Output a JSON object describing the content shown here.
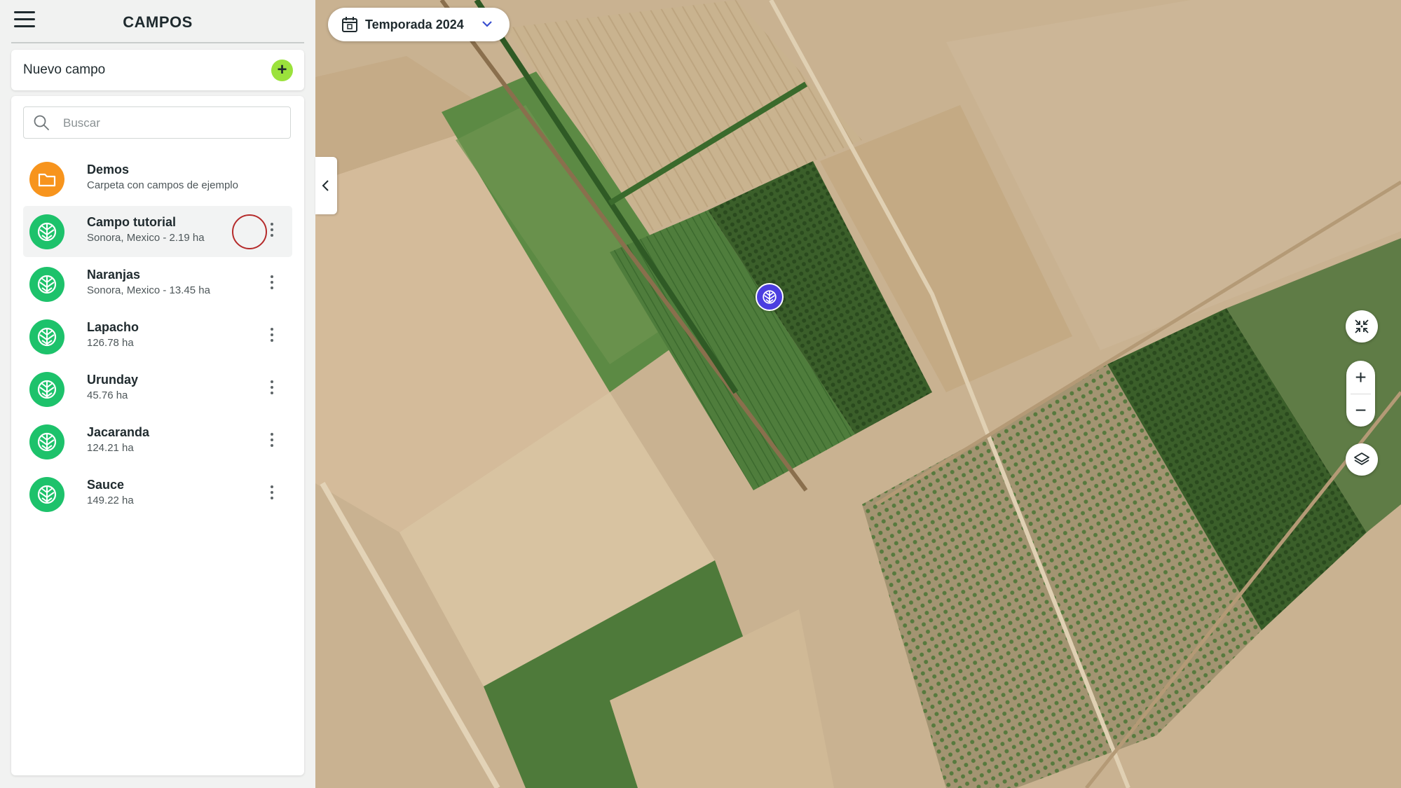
{
  "sidebar": {
    "title": "CAMPOS",
    "new_field_label": "Nuevo campo",
    "new_field_icon": "plus-icon",
    "search": {
      "placeholder": "Buscar",
      "value": ""
    },
    "items": [
      {
        "name": "Demos",
        "subtitle": "Carpeta con campos de ejemplo",
        "icon": "folder-icon",
        "color": "#f7941d"
      },
      {
        "name": "Campo tutorial",
        "subtitle": "Sonora, Mexico - 2.19 ha",
        "icon": "field-icon",
        "color": "#1dc26b",
        "selected": true
      },
      {
        "name": "Naranjas",
        "subtitle": "Sonora, Mexico - 13.45 ha",
        "icon": "field-icon",
        "color": "#1dc26b"
      },
      {
        "name": "Lapacho",
        "subtitle": "126.78 ha",
        "icon": "field-icon",
        "color": "#1dc26b"
      },
      {
        "name": "Urunday",
        "subtitle": "45.76 ha",
        "icon": "field-icon",
        "color": "#1dc26b"
      },
      {
        "name": "Jacaranda",
        "subtitle": "124.21 ha",
        "icon": "field-icon",
        "color": "#1dc26b"
      },
      {
        "name": "Sauce",
        "subtitle": "149.22 ha",
        "icon": "field-icon",
        "color": "#1dc26b"
      }
    ]
  },
  "map": {
    "season_label": "Temporada 2024",
    "season_icon": "calendar-icon",
    "zoom_in": "+",
    "zoom_out": "−",
    "controls": [
      "fit-bounds-icon",
      "layers-icon",
      "chevron-left-icon"
    ],
    "marker_color": "#4b3ee0"
  },
  "colors": {
    "accent": "#9be23c",
    "field_green": "#1dc26b",
    "folder_orange": "#f7941d",
    "text": "#1f2a2e"
  }
}
